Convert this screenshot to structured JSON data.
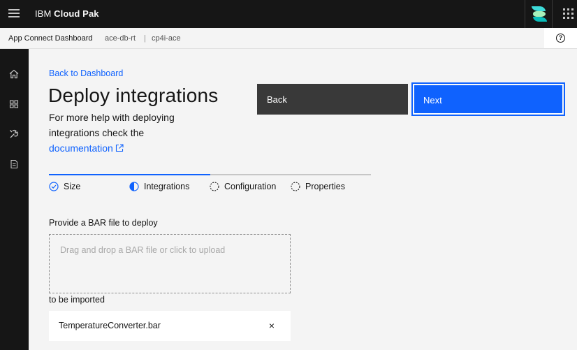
{
  "header": {
    "brand_prefix": "IBM",
    "brand_product": "Cloud Pak",
    "menu_icon": "hamburger-menu-icon",
    "logo_icon": "cloud-pak-logo-icon",
    "switcher_icon": "app-switcher-icon",
    "logo_colors": [
      "#3ddbd9",
      "#08bdba",
      "#a7f0ba"
    ]
  },
  "breadcrumb": {
    "app": "App Connect Dashboard",
    "instance": "ace-db-rt",
    "separator": "|",
    "namespace": "cp4i-ace",
    "help_icon": "help-icon",
    "help_glyph": "?"
  },
  "sidenav": {
    "items": [
      {
        "icon": "home-icon"
      },
      {
        "icon": "dashboard-icon"
      },
      {
        "icon": "tools-icon"
      },
      {
        "icon": "document-icon"
      }
    ]
  },
  "main": {
    "back_link": "Back to Dashboard",
    "title": "Deploy integrations",
    "help_text": "For more help with deploying integrations check the",
    "doc_link": "documentation",
    "back_button": "Back",
    "next_button": "Next",
    "accent_color": "#0f62fe"
  },
  "progress": {
    "completed_fraction": 0.5,
    "steps": [
      {
        "label": "Size",
        "state": "complete"
      },
      {
        "label": "Integrations",
        "state": "current"
      },
      {
        "label": "Configuration",
        "state": "incomplete"
      },
      {
        "label": "Properties",
        "state": "incomplete"
      }
    ]
  },
  "upload": {
    "label": "Provide a BAR file to deploy",
    "dropzone_text": "Drag and drop a BAR file or click to upload",
    "imported_label": "to be imported",
    "file_name": "TemperatureConverter.bar",
    "remove_glyph": "×"
  }
}
